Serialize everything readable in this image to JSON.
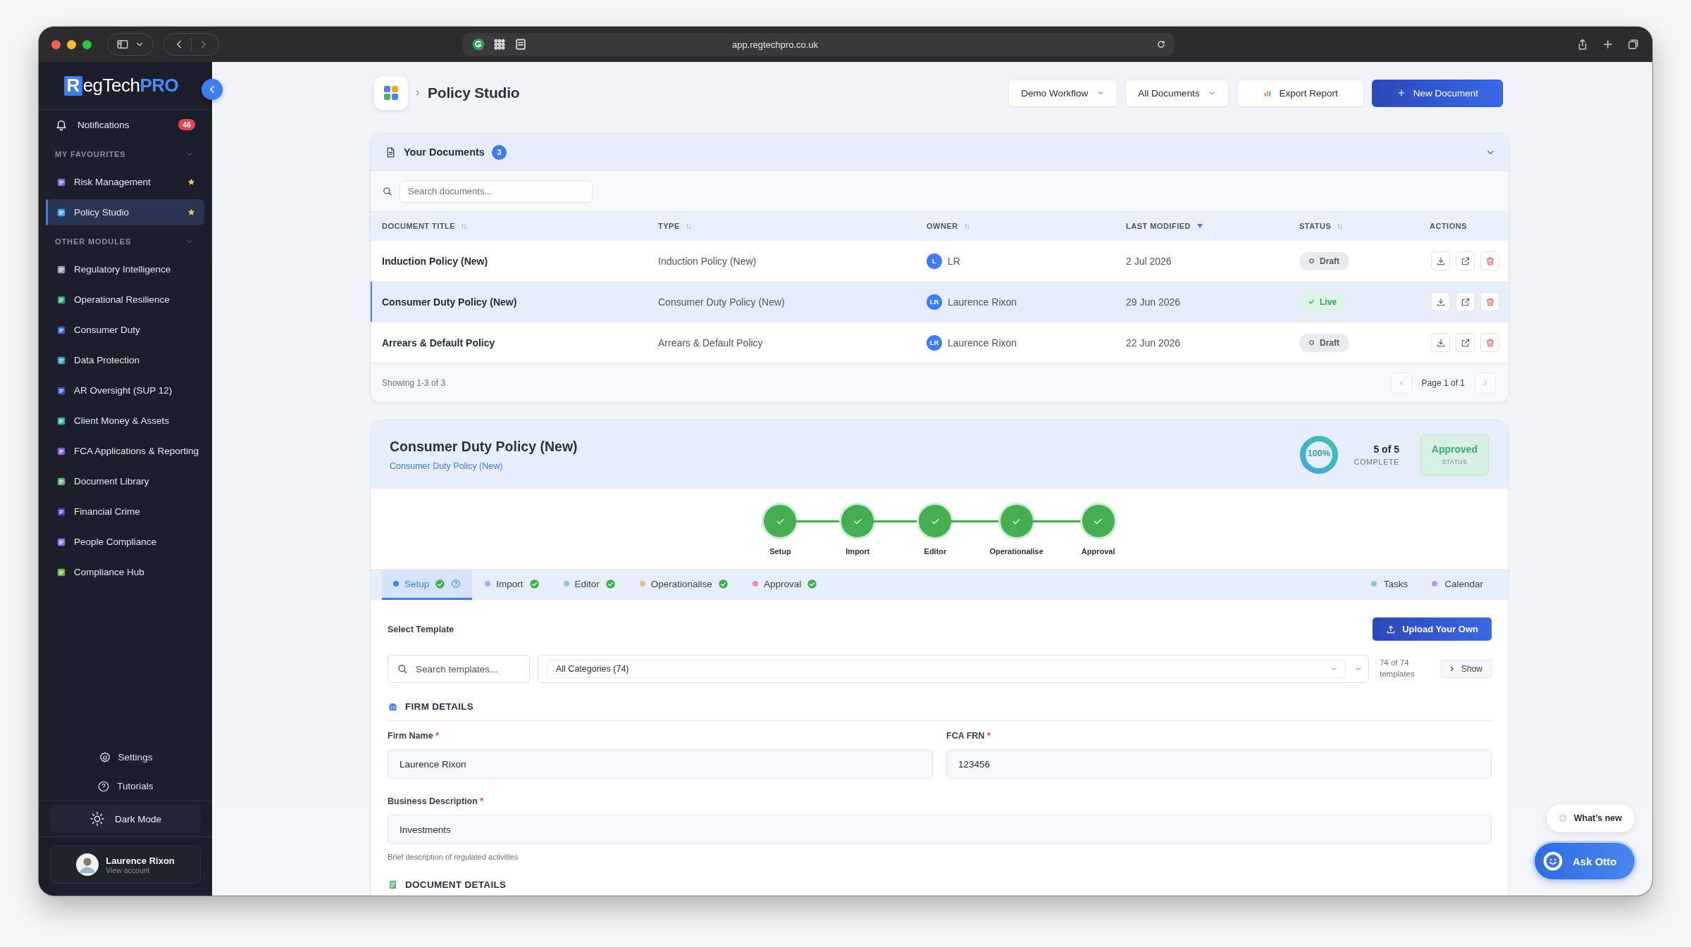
{
  "browser": {
    "url": "app.regtechpro.co.uk"
  },
  "sidebar": {
    "logo": {
      "initial": "R",
      "text": "egTech",
      "accent": "PRO"
    },
    "notifications": {
      "label": "Notifications",
      "count": "46"
    },
    "sections": [
      {
        "title": "MY FAVOURITES",
        "expanded": true,
        "items": [
          {
            "label": "Risk Management",
            "color": "#6b6fd6",
            "selected": false,
            "favourite": true
          },
          {
            "label": "Policy Studio",
            "color": "#4d9ee8",
            "selected": true,
            "favourite": true
          }
        ]
      },
      {
        "title": "OTHER MODULES",
        "expanded": true,
        "items": [
          {
            "label": "Regulatory Intelligence",
            "color": "#8a9bb0",
            "selected": false,
            "favourite": false
          },
          {
            "label": "Operational Resilience",
            "color": "#2f9e6e",
            "selected": false,
            "favourite": false
          },
          {
            "label": "Consumer Duty",
            "color": "#3a5bd9",
            "selected": false,
            "favourite": false
          },
          {
            "label": "Data Protection",
            "color": "#2aa0b8",
            "selected": false,
            "favourite": false
          },
          {
            "label": "AR Oversight (SUP 12)",
            "color": "#3b4fd0",
            "selected": false,
            "favourite": false
          },
          {
            "label": "Client Money & Assets",
            "color": "#2bb3a0",
            "selected": false,
            "favourite": false
          },
          {
            "label": "FCA Applications & Reporting",
            "color": "#7a5ad6",
            "selected": false,
            "favourite": false
          },
          {
            "label": "Document Library",
            "color": "#58b368",
            "selected": false,
            "favourite": false
          },
          {
            "label": "Financial Crime",
            "color": "#4b3fc8",
            "selected": false,
            "favourite": false
          },
          {
            "label": "People Compliance",
            "color": "#8b6fe0",
            "selected": false,
            "favourite": false
          },
          {
            "label": "Compliance Hub",
            "color": "#63b54a",
            "selected": false,
            "favourite": false
          }
        ]
      }
    ],
    "footer": [
      {
        "kind": "settings",
        "label": "Settings"
      },
      {
        "kind": "help",
        "label": "Tutorials"
      }
    ],
    "theme_button": {
      "label": "Dark Mode"
    },
    "user": {
      "name": "Laurence Rixon",
      "link": "View account"
    }
  },
  "header": {
    "title": "Policy Studio",
    "buttons": [
      {
        "kind": "dropdown",
        "label": "Demo Workflow"
      },
      {
        "kind": "dropdown",
        "label": "All Documents"
      },
      {
        "kind": "export",
        "label": "Export Report"
      },
      {
        "kind": "primary",
        "label": "New Document"
      }
    ]
  },
  "documents": {
    "title": "Your Documents",
    "count": "3",
    "expanded": true,
    "search": {
      "placeholder": "Search documents..."
    },
    "columns": [
      {
        "label": "DOCUMENT TITLE",
        "sortable": true,
        "sorted": false
      },
      {
        "label": "TYPE",
        "sortable": true,
        "sorted": false
      },
      {
        "label": "OWNER",
        "sortable": true,
        "sorted": false
      },
      {
        "label": "LAST MODIFIED",
        "sortable": true,
        "sorted": true
      },
      {
        "label": "STATUS",
        "sortable": true,
        "sorted": false
      },
      {
        "label": "ACTIONS",
        "sortable": false
      }
    ],
    "rows": [
      {
        "title": "Induction Policy (New)",
        "type": "Induction Policy (New)",
        "owner": {
          "initials": "L",
          "name": "LR"
        },
        "modified": "2 Jul 2026",
        "status": {
          "kind": "draft",
          "label": "Draft"
        },
        "selected": false
      },
      {
        "title": "Consumer Duty Policy (New)",
        "type": "Consumer Duty Policy (New)",
        "owner": {
          "initials": "LR",
          "name": "Laurence Rixon"
        },
        "modified": "29 Jun 2026",
        "status": {
          "kind": "live",
          "label": "Live"
        },
        "selected": true
      },
      {
        "title": "Arrears & Default Policy",
        "type": "Arrears & Default Policy",
        "owner": {
          "initials": "LR",
          "name": "Laurence Rixon"
        },
        "modified": "22 Jun 2026",
        "status": {
          "kind": "draft",
          "label": "Draft"
        },
        "selected": false
      }
    ],
    "footer": "Showing 1-3 of 3",
    "page": "Page 1 of 1"
  },
  "policy": {
    "title": "Consumer Duty Policy (New)",
    "subtitle": "Consumer Duty Policy (New)",
    "progress": {
      "level": 1,
      "label": "100%"
    },
    "count": "5 of 5",
    "count_label": "COMPLETE",
    "status": {
      "label": "Approved",
      "caption": "STATUS"
    },
    "steps": [
      {
        "label": "Setup",
        "done": true
      },
      {
        "label": "Import",
        "done": true
      },
      {
        "label": "Editor",
        "done": true
      },
      {
        "label": "Operationalise",
        "done": true
      },
      {
        "label": "Approval",
        "done": true
      }
    ],
    "tabs": [
      {
        "label": "Setup",
        "color": "#3b82f6",
        "done": true,
        "help": true,
        "selected": true
      },
      {
        "label": "Import",
        "color": "#9db8ea",
        "done": true,
        "help": false,
        "selected": false
      },
      {
        "label": "Editor",
        "color": "#86cbd9",
        "done": true,
        "help": false,
        "selected": false
      },
      {
        "label": "Operationalise",
        "color": "#f2b882",
        "done": true,
        "help": false,
        "selected": false
      },
      {
        "label": "Approval",
        "color": "#ec8fb0",
        "done": true,
        "help": false,
        "selected": false
      }
    ],
    "side_tabs": [
      {
        "label": "Tasks",
        "color": "#7fd4ad"
      },
      {
        "label": "Calendar",
        "color": "#b39cf5"
      }
    ],
    "template": {
      "title": "Select Template",
      "upload": "Upload Your Own",
      "search": {
        "placeholder": "Search templates..."
      },
      "category": "All Categories (74)",
      "count": "74 of 74 templates",
      "show": "Show"
    },
    "firm": {
      "title": "FIRM DETAILS",
      "fields": [
        {
          "label": "Firm Name",
          "marker": "*",
          "value": "Laurence Rixon"
        },
        {
          "label": "FCA FRN",
          "marker": "*",
          "value": "123456"
        },
        {
          "label": "Business Description",
          "marker": "*",
          "value": "Investments",
          "hint": "Brief description of regulated activities"
        }
      ]
    },
    "next_section": "DOCUMENT DETAILS"
  },
  "floating": {
    "whats_new": "What’s new",
    "assistant": "Ask Otto"
  }
}
